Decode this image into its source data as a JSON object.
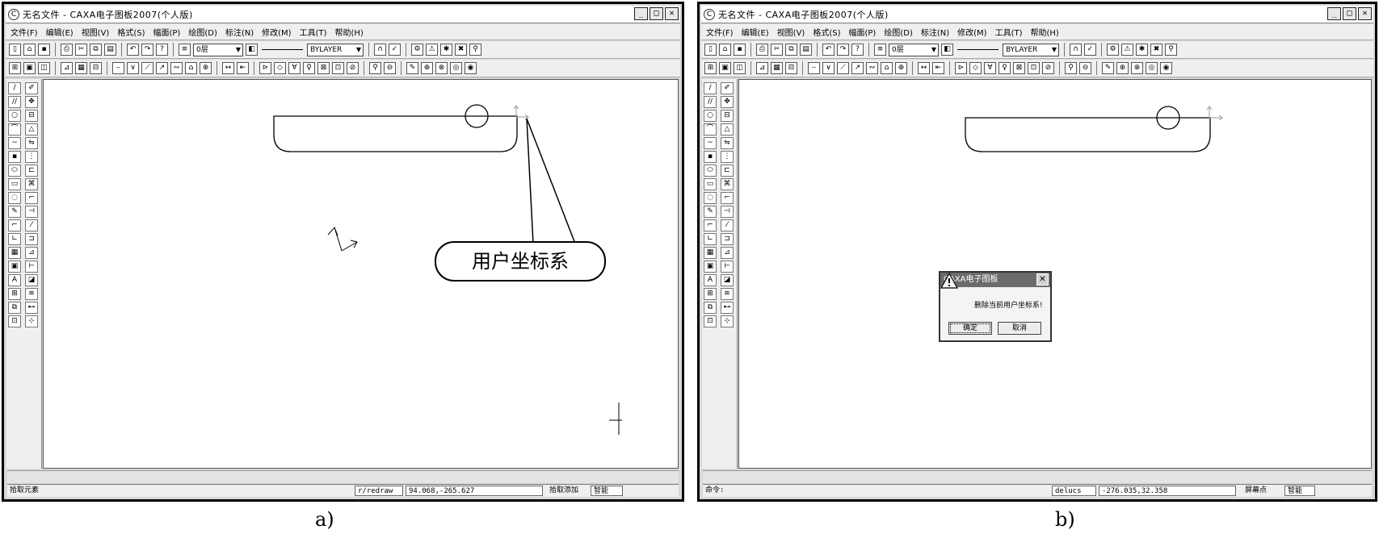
{
  "panel_a": {
    "title": "无名文件 - CAXA电子图板2007(个人版)",
    "window_buttons": [
      "_",
      "□",
      "✕"
    ],
    "menu": [
      "文件(F)",
      "编辑(E)",
      "视图(V)",
      "格式(S)",
      "幅面(P)",
      "绘图(D)",
      "标注(N)",
      "修改(M)",
      "工具(T)",
      "帮助(H)"
    ],
    "layer_value": "0层",
    "linetype_value": "BYLAYER",
    "callout_label": "用户坐标系",
    "status": {
      "prompt": "拾取元素",
      "command": "r/redraw",
      "coords": "94.068,-265.627",
      "snap_label": "拾取添加",
      "mode": "智能"
    },
    "caption": "a)"
  },
  "panel_b": {
    "title": "无名文件 - CAXA电子图板2007(个人版)",
    "window_buttons": [
      "_",
      "□",
      "✕"
    ],
    "menu": [
      "文件(F)",
      "编辑(E)",
      "视图(V)",
      "格式(S)",
      "幅面(P)",
      "绘图(D)",
      "标注(N)",
      "修改(M)",
      "工具(T)",
      "帮助(H)"
    ],
    "layer_value": "0层",
    "linetype_value": "BYLAYER",
    "dialog": {
      "title": "CAXA电子图板",
      "message": "删除当前用户坐标系!",
      "ok_label": "确定",
      "cancel_label": "取消",
      "close_glyph": "✕"
    },
    "status": {
      "prompt": "命令:",
      "command": "delucs",
      "coords": "-276.035,32.358",
      "snap_label": "屏幕点",
      "mode": "智能"
    },
    "caption": "b)"
  },
  "icons": {
    "toolbar1": [
      "new-icon",
      "open-icon",
      "save-icon",
      "print-icon",
      "cut-icon",
      "copy-icon",
      "paste-icon",
      "undo-icon",
      "redo-icon",
      "help-icon",
      "layer-icon",
      "color-icon",
      "linetype-icon",
      "width-icon"
    ],
    "toolbar2": [
      "zoom-icon",
      "pan-icon",
      "view-icon",
      "measure-icon",
      "dimension-icon",
      "snap-icon"
    ],
    "sidebar_glyphs_col1": [
      "/",
      "//",
      "○",
      "⌒",
      "~",
      "▪",
      "⬭",
      "▭",
      "◌",
      "✎",
      "⌐",
      "∟",
      "▦",
      "▣",
      "A",
      "⊞",
      "⧉",
      "⊡"
    ],
    "sidebar_glyphs_col2": [
      "✐",
      "✥",
      "⊟",
      "△",
      "⇋",
      "⋮",
      "⊏",
      "⌘",
      "⌐",
      "⊣",
      "⁄",
      "⊐",
      "⊿",
      "⊢",
      "◪",
      "≋",
      "⊷",
      "⊹"
    ]
  }
}
